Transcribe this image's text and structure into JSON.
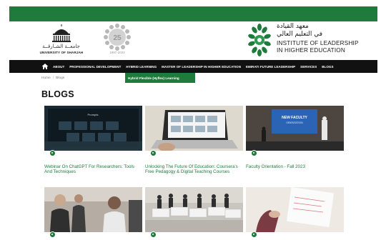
{
  "header": {
    "sharjah_ar": "جامعــة الشـارقــة",
    "sharjah_en": "UNIVERSITY OF SHARJAH",
    "anniversary_years": "1997-2022",
    "anniversary_number": "25",
    "institute_ar_line1": "معهد القيادة",
    "institute_ar_line2": "في التعليم العالي",
    "institute_en_line1": "INSTITUTE OF LEADERSHIP",
    "institute_en_line2": "IN HIGHER EDUCATION"
  },
  "nav": {
    "items": [
      "ABOUT",
      "PROFESSIONAL DEVELOPMENT",
      "HYBRID LEARNING",
      "MASTER OF LEADERSHIP IN HIGHER EDUCATION",
      "EMIRATI FUTURE LEADERSHIP",
      "SERVICES",
      "BLOGS"
    ],
    "dropdown_item": "Hybrid Flexible (Hyflex) Learning"
  },
  "breadcrumb": {
    "home": "Home",
    "current": "Blogs"
  },
  "page_title": "BLOGS",
  "cards": [
    {
      "title": "Webinar On ChatGPT For Researchers: Tools And Techniques"
    },
    {
      "title": "Unlocking The Future Of Education: Coursera’s Free Pedagogy & Digital Teaching Courses"
    },
    {
      "title": "Faculty Orientation - Fall 2023"
    },
    {
      "title": ""
    },
    {
      "title": ""
    },
    {
      "title": ""
    }
  ],
  "thumb_text": {
    "chatgpt_screen": "Prompts",
    "orientation_screen_line1": "NEW FACULTY",
    "orientation_screen_line2": "ORIENTATION"
  },
  "colors": {
    "brand_green": "#1e7b3c",
    "nav_bg": "#111111"
  }
}
